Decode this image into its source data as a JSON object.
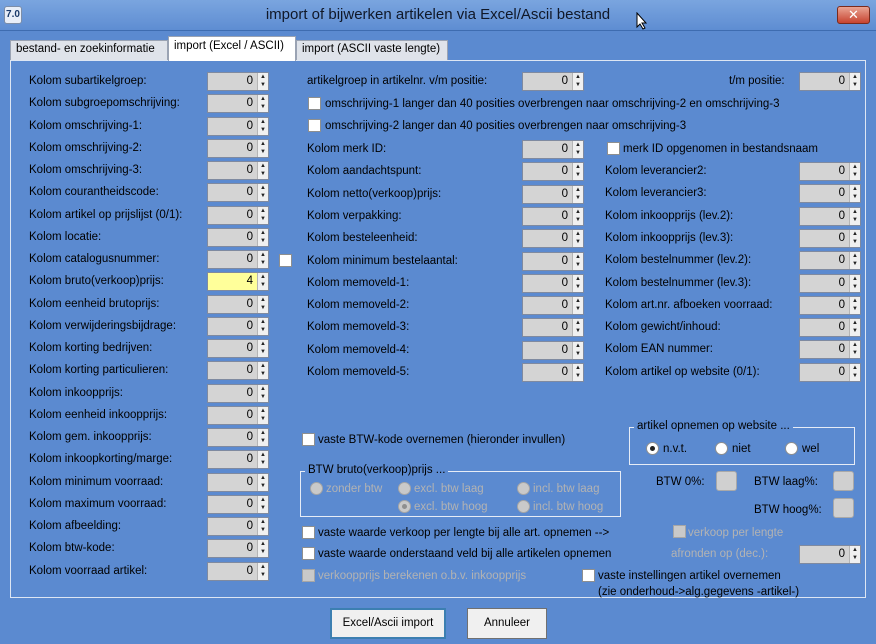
{
  "window": {
    "title": "import of bijwerken artikelen via Excel/Ascii bestand",
    "app_icon_text": "7.0",
    "close_label": "✕"
  },
  "tabs": [
    {
      "label": "bestand- en zoekinformatie",
      "active": false
    },
    {
      "label": "import (Excel / ASCII)",
      "active": true
    },
    {
      "label": "import (ASCII vaste lengte)",
      "active": false
    }
  ],
  "left_fields": [
    {
      "label": "Kolom subartikelgroep:",
      "value": "0"
    },
    {
      "label": "Kolom subgroepomschrijving:",
      "value": "0"
    },
    {
      "label": "Kolom omschrijving-1:",
      "value": "0"
    },
    {
      "label": "Kolom omschrijving-2:",
      "value": "0"
    },
    {
      "label": "Kolom omschrijving-3:",
      "value": "0"
    },
    {
      "label": "Kolom courantheidscode:",
      "value": "0"
    },
    {
      "label": "Kolom artikel op prijslijst (0/1):",
      "value": "0"
    },
    {
      "label": "Kolom locatie:",
      "value": "0"
    },
    {
      "label": "Kolom catalogusnummer:",
      "value": "0"
    },
    {
      "label": "Kolom bruto(verkoop)prijs:",
      "value": "4"
    },
    {
      "label": "Kolom eenheid brutoprijs:",
      "value": "0"
    },
    {
      "label": "Kolom verwijderingsbijdrage:",
      "value": "0"
    },
    {
      "label": "Kolom korting bedrijven:",
      "value": "0"
    },
    {
      "label": "Kolom korting particulieren:",
      "value": "0"
    },
    {
      "label": "Kolom inkoopprijs:",
      "value": "0"
    },
    {
      "label": "Kolom eenheid inkoopprijs:",
      "value": "0"
    },
    {
      "label": "Kolom gem. inkoopprijs:",
      "value": "0"
    },
    {
      "label": "Kolom inkoopkorting/marge:",
      "value": "0"
    },
    {
      "label": "Kolom minimum voorraad:",
      "value": "0"
    },
    {
      "label": "Kolom maximum voorraad:",
      "value": "0"
    },
    {
      "label": "Kolom afbeelding:",
      "value": "0"
    },
    {
      "label": "Kolom btw-kode:",
      "value": "0"
    },
    {
      "label": "Kolom voorraad artikel:",
      "value": "0"
    }
  ],
  "artikelgroep": {
    "label": "artikelgroep in artikelnr. v/m positie:",
    "value": "0",
    "tm_label": "t/m positie:",
    "tm_value": "0"
  },
  "checks": {
    "omschr1": "omschrijving-1 langer dan 40 posities overbrengen naar omschrijving-2 en omschrijving-3",
    "omschr2": "omschrijving-2 langer dan 40 posities overbrengen naar omschrijving-3",
    "merk_in_naam": "merk ID opgenomen in bestandsnaam",
    "vaste_btw": "vaste BTW-kode overnemen (hieronder invullen)",
    "vaste_lengte": "vaste waarde verkoop per lengte bij alle art. opnemen -->",
    "vaste_veld": "vaste waarde onderstaand veld bij alle artikelen opnemen",
    "verkoopprijs_berekenen": "verkoopprijs berekenen o.b.v. inkoopprijs",
    "vaste_instellingen": "vaste instellingen artikel overnemen",
    "vaste_instellingen_note": "(zie onderhoud->alg.gegevens -artikel-)",
    "verkoop_per_lengte": "verkoop per lengte"
  },
  "mid_fields": [
    {
      "label": "Kolom merk ID:",
      "value": "0"
    },
    {
      "label": "Kolom aandachtspunt:",
      "value": "0"
    },
    {
      "label": "Kolom netto(verkoop)prijs:",
      "value": "0"
    },
    {
      "label": "Kolom verpakking:",
      "value": "0"
    },
    {
      "label": "Kolom besteleenheid:",
      "value": "0"
    },
    {
      "label": "Kolom minimum bestelaantal:",
      "value": "0"
    },
    {
      "label": "Kolom memoveld-1:",
      "value": "0"
    },
    {
      "label": "Kolom memoveld-2:",
      "value": "0"
    },
    {
      "label": "Kolom memoveld-3:",
      "value": "0"
    },
    {
      "label": "Kolom memoveld-4:",
      "value": "0"
    },
    {
      "label": "Kolom memoveld-5:",
      "value": "0"
    }
  ],
  "right_fields": [
    {
      "label": "Kolom leverancier2:",
      "value": "0"
    },
    {
      "label": "Kolom leverancier3:",
      "value": "0"
    },
    {
      "label": "Kolom inkoopprijs (lev.2):",
      "value": "0"
    },
    {
      "label": "Kolom inkoopprijs (lev.3):",
      "value": "0"
    },
    {
      "label": "Kolom bestelnummer (lev.2):",
      "value": "0"
    },
    {
      "label": "Kolom bestelnummer (lev.3):",
      "value": "0"
    },
    {
      "label": "Kolom art.nr. afboeken voorraad:",
      "value": "0"
    },
    {
      "label": "Kolom gewicht/inhoud:",
      "value": "0"
    },
    {
      "label": "Kolom EAN nummer:",
      "value": "0"
    },
    {
      "label": "Kolom artikel op website (0/1):",
      "value": "0"
    }
  ],
  "website_group": {
    "title": "artikel opnemen op website ...",
    "options": [
      "n.v.t.",
      "niet",
      "wel"
    ],
    "selected": "n.v.t."
  },
  "btw_group": {
    "title": "BTW bruto(verkoop)prijs ...",
    "options": [
      "zonder btw",
      "excl. btw laag",
      "incl. btw laag",
      "excl. btw hoog",
      "incl. btw hoog"
    ],
    "selected": "excl. btw hoog"
  },
  "btw_pct": {
    "zero": "BTW 0%:",
    "laag": "BTW laag%:",
    "hoog": "BTW hoog%:"
  },
  "afronden": {
    "label": "afronden op (dec.):",
    "value": "0"
  },
  "buttons": {
    "import": "Excel/Ascii import",
    "cancel": "Annuleer"
  }
}
